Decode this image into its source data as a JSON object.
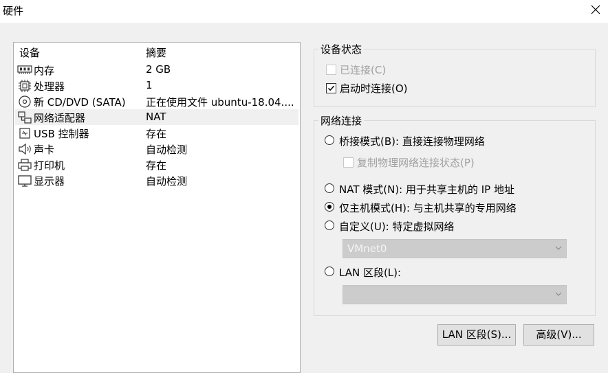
{
  "window": {
    "title": "硬件"
  },
  "device_list": {
    "headers": {
      "device": "设备",
      "summary": "摘要"
    },
    "rows": [
      {
        "icon": "memory-icon",
        "name": "内存",
        "summary": "2 GB"
      },
      {
        "icon": "processor-icon",
        "name": "处理器",
        "summary": "1"
      },
      {
        "icon": "cd-dvd-icon",
        "name": "新 CD/DVD (SATA)",
        "summary": "正在使用文件 ubuntu-18.04...."
      },
      {
        "icon": "network-adapter-icon",
        "name": "网络适配器",
        "summary": "NAT"
      },
      {
        "icon": "usb-icon",
        "name": "USB 控制器",
        "summary": "存在"
      },
      {
        "icon": "speaker-icon",
        "name": "声卡",
        "summary": "自动检测"
      },
      {
        "icon": "printer-icon",
        "name": "打印机",
        "summary": "存在"
      },
      {
        "icon": "display-icon",
        "name": "显示器",
        "summary": "自动检测"
      }
    ],
    "selected_row": "网络适配器"
  },
  "device_status": {
    "title": "设备状态",
    "connected": {
      "label": "已连接(C)",
      "checked": false,
      "disabled": true
    },
    "connect_at_power_on": {
      "label": "启动时连接(O)",
      "checked": true,
      "disabled": false
    }
  },
  "network_connection": {
    "title": "网络连接",
    "bridged": {
      "label": "桥接模式(B): 直接连接物理网络",
      "selected": false
    },
    "replicate_state": {
      "label": "复制物理网络连接状态(P)",
      "checked": false,
      "disabled": true
    },
    "nat": {
      "label": "NAT 模式(N): 用于共享主机的 IP 地址",
      "selected": false
    },
    "host_only": {
      "label": "仅主机模式(H): 与主机共享的专用网络",
      "selected": true
    },
    "custom": {
      "label": "自定义(U): 特定虚拟网络",
      "selected": false
    },
    "custom_select": {
      "value": "VMnet0",
      "disabled": true
    },
    "lan_segment": {
      "label": "LAN 区段(L):",
      "selected": false
    },
    "lan_select": {
      "value": "",
      "disabled": true
    }
  },
  "buttons": {
    "lan_segments": "LAN 区段(S)...",
    "advanced": "高级(V)..."
  },
  "colors": {
    "selected_row": "#f0f0f0",
    "disabled_text": "#a0a0a0",
    "disabled_combo": "#cccccc"
  }
}
